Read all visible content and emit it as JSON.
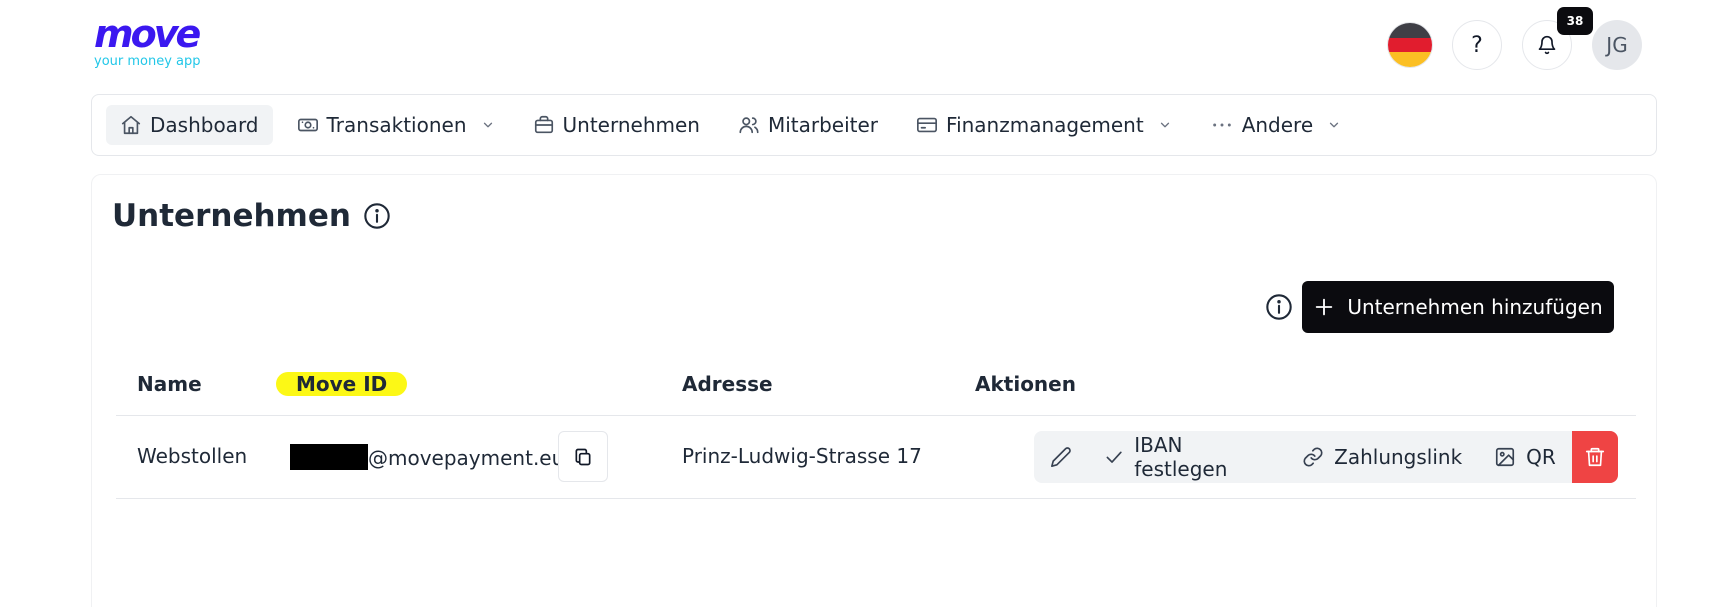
{
  "brand": {
    "logo_word": "move",
    "tagline": "your money app"
  },
  "header": {
    "help_label": "?",
    "notifications_count": "38",
    "avatar_initials": "JG",
    "language_flag": "germany"
  },
  "nav": {
    "items": [
      {
        "label": "Dashboard",
        "icon": "home-icon"
      },
      {
        "label": "Transaktionen",
        "icon": "cash-icon"
      },
      {
        "label": "Unternehmen",
        "icon": "briefcase-icon"
      },
      {
        "label": "Mitarbeiter",
        "icon": "users-icon"
      },
      {
        "label": "Finanzmanagement",
        "icon": "credit-card-icon"
      },
      {
        "label": "Andere",
        "icon": "more-dots-icon"
      }
    ]
  },
  "page": {
    "title": "Unternehmen",
    "add_button_label": "Unternehmen hinzufügen"
  },
  "table": {
    "columns": [
      "Name",
      "Move ID",
      "Adresse",
      "Aktionen"
    ],
    "rows": [
      {
        "name": "Webstollen",
        "move_id_suffix": "@movepayment.eu",
        "address": "Prinz-Ludwig-Strasse 17",
        "actions": {
          "iban": "IBAN festlegen",
          "payment_link": "Zahlungslink",
          "qr": "QR"
        }
      }
    ]
  },
  "colors": {
    "brand_primary": "#3b18f0",
    "brand_secondary": "#22c7e8",
    "highlight": "#fcf816",
    "danger": "#ef4444",
    "dark_button": "#0b0b0f"
  }
}
